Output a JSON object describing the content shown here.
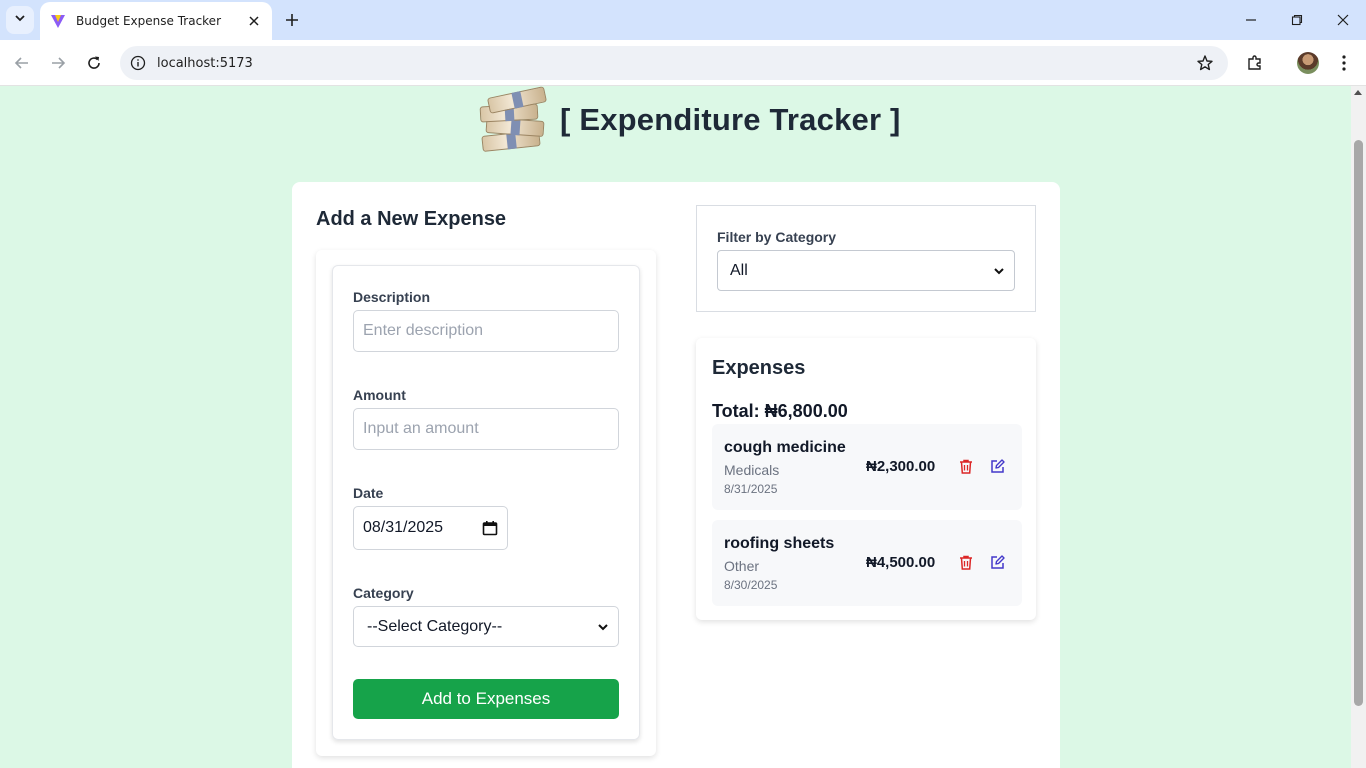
{
  "browser": {
    "tab_title": "Budget Expense Tracker",
    "url": "localhost:5173"
  },
  "page": {
    "title": "[ Expenditure Tracker ]"
  },
  "form": {
    "heading": "Add a New Expense",
    "description_label": "Description",
    "description_placeholder": "Enter description",
    "description_value": "",
    "amount_label": "Amount",
    "amount_placeholder": "Input an amount",
    "amount_value": "",
    "date_label": "Date",
    "date_value": "08/31/2025",
    "category_label": "Category",
    "category_selected": "--Select Category--",
    "submit_label": "Add to Expenses"
  },
  "filter": {
    "label": "Filter by Category",
    "selected": "All"
  },
  "expenses": {
    "heading": "Expenses",
    "total_label": "Total: ₦6,800.00",
    "items": [
      {
        "description": "cough medicine",
        "category": "Medicals",
        "date": "8/31/2025",
        "amount": "₦2,300.00"
      },
      {
        "description": "roofing sheets",
        "category": "Other",
        "date": "8/30/2025",
        "amount": "₦4,500.00"
      }
    ]
  },
  "colors": {
    "page_background": "#dcf8e6",
    "primary_button": "#16a34a",
    "delete_icon": "#dc2626",
    "edit_icon": "#4338ca"
  },
  "icons": [
    "chevron-down-icon",
    "vite-favicon-icon",
    "close-icon",
    "plus-icon",
    "minimize-icon",
    "restore-icon",
    "back-icon",
    "forward-icon",
    "reload-icon",
    "info-icon",
    "star-icon",
    "extensions-icon",
    "avatar",
    "more-icon",
    "money-stack-logo",
    "calendar-icon",
    "trash-icon",
    "edit-icon"
  ]
}
